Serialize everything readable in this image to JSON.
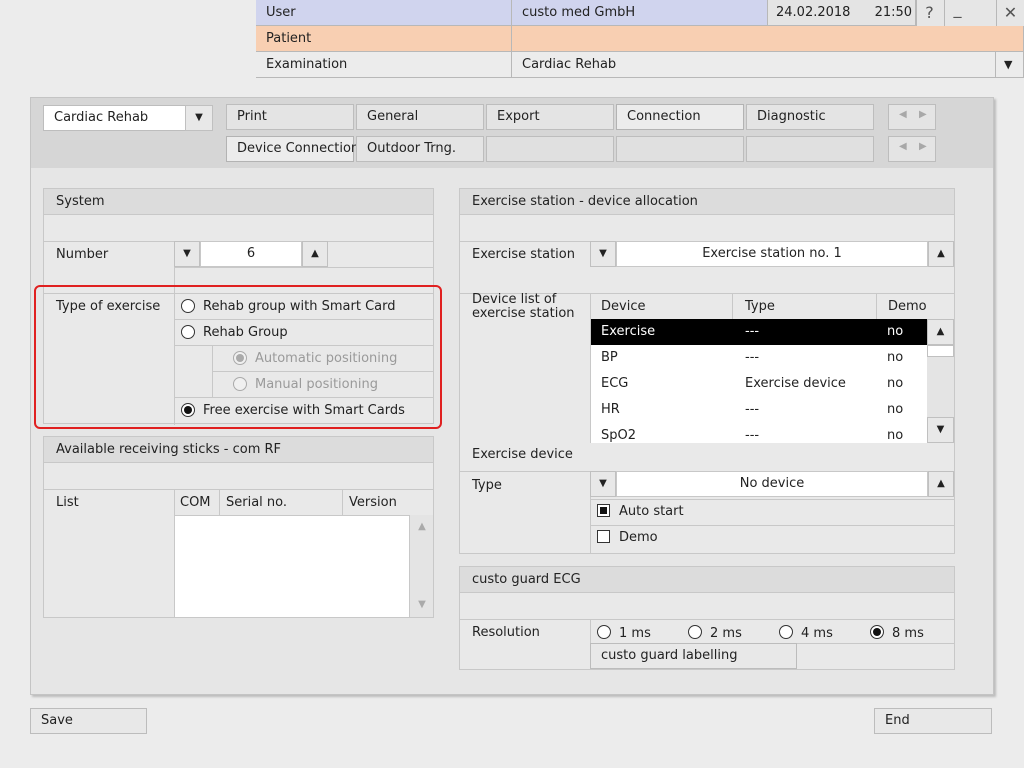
{
  "header": {
    "user_label": "User",
    "user_value": "custo med GmbH",
    "date": "24.02.2018",
    "time": "21:50",
    "patient_label": "Patient",
    "patient_value": "",
    "examination_label": "Examination",
    "examination_value": "Cardiac Rehab",
    "help_icon": "?",
    "minimize_icon": "_",
    "close_icon": "✕",
    "dropdown_icon": "▼"
  },
  "toolbar": {
    "module_select": "Cardiac Rehab",
    "tabs_row1": [
      "Print",
      "General",
      "Export",
      "Connection",
      "Diagnostic"
    ],
    "tabs_row2": [
      "Device Connection",
      "Outdoor Trng."
    ]
  },
  "system": {
    "title": "System",
    "number_label": "Number",
    "number_value": "6",
    "type_label": "Type of exercise",
    "options": {
      "rehab_smart": "Rehab group with Smart Card",
      "rehab_group": "Rehab Group",
      "auto_pos": "Automatic positioning",
      "manual_pos": "Manual positioning",
      "free_smart": "Free exercise with Smart Cards"
    },
    "selected": "free_smart"
  },
  "sticks": {
    "title": "Available receiving sticks - com RF",
    "list_label": "List",
    "columns": [
      "COM",
      "Serial no.",
      "Version"
    ]
  },
  "allocation": {
    "title": "Exercise station - device allocation",
    "station_label": "Exercise station",
    "station_value": "Exercise station no. 1",
    "device_list_label": "Device list of exercise station",
    "columns": [
      "Device",
      "Type",
      "Demo"
    ],
    "rows": [
      {
        "device": "Exercise",
        "type": "---",
        "demo": "no",
        "selected": true
      },
      {
        "device": "BP",
        "type": "---",
        "demo": "no"
      },
      {
        "device": "ECG",
        "type": "Exercise device",
        "demo": "no"
      },
      {
        "device": "HR",
        "type": "---",
        "demo": "no"
      },
      {
        "device": "SpO2",
        "type": "---",
        "demo": "no"
      }
    ],
    "exercise_device_label": "Exercise device",
    "type_label": "Type",
    "type_value": "No device",
    "auto_start_label": "Auto start",
    "auto_start_checked": true,
    "demo_label": "Demo",
    "demo_checked": false
  },
  "guard": {
    "title": "custo guard ECG",
    "resolution_label": "Resolution",
    "options": [
      "1 ms",
      "2 ms",
      "4 ms",
      "8 ms"
    ],
    "selected_index": 3,
    "labelling_button": "custo guard labelling"
  },
  "footer": {
    "save": "Save",
    "end": "End"
  },
  "colors": {
    "user_bg": "#d0d4ee",
    "patient_bg": "#f8cfb2",
    "highlight_border": "#e02020",
    "selected_row_bg": "#000000"
  }
}
